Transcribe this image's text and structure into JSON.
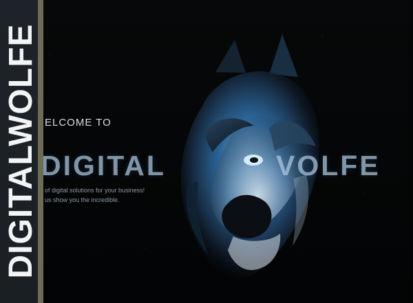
{
  "sidebar": {
    "brand_vertical": "DIGITALWOLFE"
  },
  "hero": {
    "welcome": "ELCOME TO",
    "title_left": "DIGITAL",
    "title_right": "VOLFE",
    "tagline_line1": "of digital solutions for your business!",
    "tagline_line2": "us show you the incredible."
  },
  "icons": {
    "hero_image": "wolf-illustration-icon"
  },
  "colors": {
    "sidebar": "#1d2328",
    "sidebar_accent": "#6e6b54",
    "background": "#050607",
    "title": "#b4cce2"
  }
}
